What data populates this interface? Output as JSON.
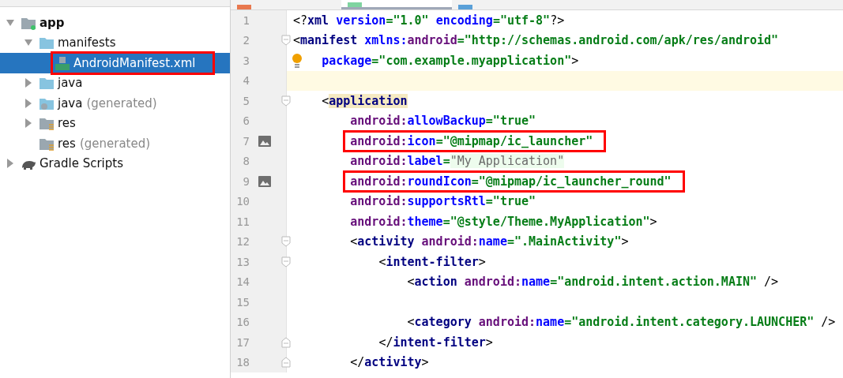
{
  "editor_tabs": [
    {
      "selected": false
    },
    {
      "selected": true
    },
    {
      "selected": false
    }
  ],
  "project_tree": [
    {
      "label": "app",
      "kind": "module",
      "bold": true,
      "expandable": true,
      "expanded": true,
      "selected": false,
      "annotated": false,
      "children": [
        {
          "label": "manifests",
          "kind": "folder",
          "expandable": true,
          "expanded": true,
          "selected": false,
          "annotated": false,
          "children": [
            {
              "label": "AndroidManifest.xml",
              "kind": "manifest",
              "expandable": false,
              "selected": true,
              "annotated": true
            }
          ]
        },
        {
          "label": "java",
          "kind": "folder",
          "expandable": true,
          "expanded": false,
          "selected": false,
          "annotated": false
        },
        {
          "label": "java",
          "suffix": "(generated)",
          "kind": "generated",
          "expandable": true,
          "expanded": false,
          "selected": false,
          "annotated": false
        },
        {
          "label": "res",
          "kind": "resources",
          "expandable": true,
          "expanded": false,
          "selected": false,
          "annotated": false
        },
        {
          "label": "res",
          "suffix": "(generated)",
          "kind": "resources",
          "expandable": false,
          "selected": false,
          "annotated": false
        }
      ]
    },
    {
      "label": "Gradle Scripts",
      "kind": "gradle",
      "expandable": true,
      "expanded": false,
      "selected": false,
      "annotated": false
    }
  ],
  "code_lines": [
    {
      "number": "1",
      "tokens": [
        {
          "kind": "punct",
          "text": "<?"
        },
        {
          "kind": "tag",
          "text": "xml "
        },
        {
          "kind": "attr",
          "text": "version"
        },
        {
          "kind": "str",
          "text": "=\"1.0\" "
        },
        {
          "kind": "attr",
          "text": "encoding"
        },
        {
          "kind": "str",
          "text": "=\"utf-8\""
        },
        {
          "kind": "punct",
          "text": "?>"
        }
      ]
    },
    {
      "number": "2",
      "fold_start": true,
      "tokens": [
        {
          "kind": "punct",
          "text": "<"
        },
        {
          "kind": "tag",
          "text": "manifest "
        },
        {
          "kind": "attr",
          "text": "xmlns:"
        },
        {
          "kind": "ns",
          "text": "android"
        },
        {
          "kind": "str",
          "text": "=\"http://schemas.android.com/apk/res/android\""
        }
      ]
    },
    {
      "number": "3",
      "bulb": true,
      "tokens": [
        {
          "kind": "attr",
          "text": "    package"
        },
        {
          "kind": "str",
          "text": "=\"com.example.myapplication\""
        },
        {
          "kind": "punct",
          "text": ">"
        }
      ]
    },
    {
      "number": "4",
      "current": true
    },
    {
      "number": "5",
      "fold_start": true,
      "tokens": [
        {
          "kind": "punct",
          "text": "    <"
        },
        {
          "kind": "tag",
          "text": "application",
          "matched": true
        }
      ]
    },
    {
      "number": "6",
      "tokens": [
        {
          "kind": "ns",
          "text": "        android:"
        },
        {
          "kind": "attr",
          "text": "allowBackup"
        },
        {
          "kind": "str",
          "text": "=\"true\""
        }
      ]
    },
    {
      "number": "7",
      "image_preview": true,
      "annotated": true,
      "tokens": [
        {
          "kind": "ns",
          "text": "        android:"
        },
        {
          "kind": "attr",
          "text": "icon"
        },
        {
          "kind": "str",
          "text": "=\"@mipmap/ic_launcher\""
        }
      ]
    },
    {
      "number": "8",
      "tokens": [
        {
          "kind": "ns",
          "text": "        android:"
        },
        {
          "kind": "attr",
          "text": "label"
        },
        {
          "kind": "str",
          "text": "="
        },
        {
          "kind": "folded",
          "text": "\"My Application\""
        }
      ]
    },
    {
      "number": "9",
      "image_preview": true,
      "annotated": true,
      "tokens": [
        {
          "kind": "ns",
          "text": "        android:"
        },
        {
          "kind": "attr",
          "text": "roundIcon"
        },
        {
          "kind": "str",
          "text": "=\"@mipmap/ic_launcher_round\""
        }
      ]
    },
    {
      "number": "10",
      "tokens": [
        {
          "kind": "ns",
          "text": "        android:"
        },
        {
          "kind": "attr",
          "text": "supportsRtl"
        },
        {
          "kind": "str",
          "text": "=\"true\""
        }
      ]
    },
    {
      "number": "11",
      "tokens": [
        {
          "kind": "ns",
          "text": "        android:"
        },
        {
          "kind": "attr",
          "text": "theme"
        },
        {
          "kind": "str",
          "text": "=\"@style/Theme.MyApplication\""
        },
        {
          "kind": "punct",
          "text": ">"
        }
      ]
    },
    {
      "number": "12",
      "fold_start": true,
      "tokens": [
        {
          "kind": "punct",
          "text": "        <"
        },
        {
          "kind": "tag",
          "text": "activity "
        },
        {
          "kind": "ns",
          "text": "android:"
        },
        {
          "kind": "attr",
          "text": "name"
        },
        {
          "kind": "str",
          "text": "=\".MainActivity\""
        },
        {
          "kind": "punct",
          "text": ">"
        }
      ]
    },
    {
      "number": "13",
      "fold_start": true,
      "tokens": [
        {
          "kind": "punct",
          "text": "            <"
        },
        {
          "kind": "tag",
          "text": "intent-filter"
        },
        {
          "kind": "punct",
          "text": ">"
        }
      ]
    },
    {
      "number": "14",
      "tokens": [
        {
          "kind": "punct",
          "text": "                <"
        },
        {
          "kind": "tag",
          "text": "action "
        },
        {
          "kind": "ns",
          "text": "android:"
        },
        {
          "kind": "attr",
          "text": "name"
        },
        {
          "kind": "str",
          "text": "=\"android.intent.action.MAIN\" "
        },
        {
          "kind": "punct",
          "text": "/>"
        }
      ]
    },
    {
      "number": "15"
    },
    {
      "number": "16",
      "tokens": [
        {
          "kind": "punct",
          "text": "                <"
        },
        {
          "kind": "tag",
          "text": "category "
        },
        {
          "kind": "ns",
          "text": "android:"
        },
        {
          "kind": "attr",
          "text": "name"
        },
        {
          "kind": "str",
          "text": "=\"android.intent.category.LAUNCHER\" "
        },
        {
          "kind": "punct",
          "text": "/>"
        }
      ]
    },
    {
      "number": "17",
      "fold_end": true,
      "tokens": [
        {
          "kind": "punct",
          "text": "            </"
        },
        {
          "kind": "tag",
          "text": "intent-filter"
        },
        {
          "kind": "punct",
          "text": ">"
        }
      ]
    },
    {
      "number": "18",
      "fold_end": true,
      "tokens": [
        {
          "kind": "punct",
          "text": "        </"
        },
        {
          "kind": "tag",
          "text": "activity"
        },
        {
          "kind": "punct",
          "text": ">"
        }
      ]
    }
  ]
}
